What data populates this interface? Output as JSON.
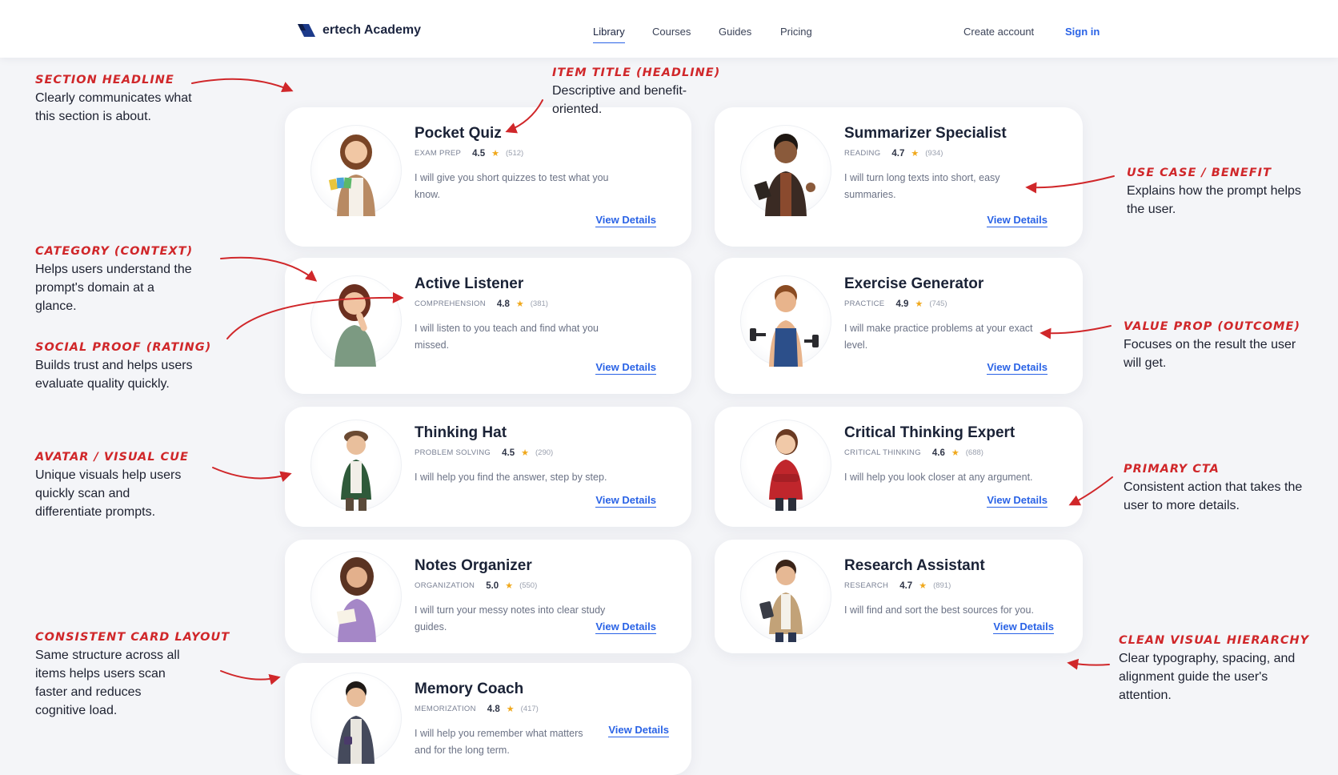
{
  "nav": {
    "brand": "ertech Academy",
    "links": [
      "Library",
      "Courses",
      "Guides",
      "Pricing"
    ],
    "create_account": "Create account",
    "sign_in": "Sign in"
  },
  "colors": {
    "accent": "#2a63e6",
    "annotation": "#d0272a",
    "star": "#f0a81b"
  },
  "cards": [
    {
      "title": "Pocket Quiz",
      "category": "EXAM PREP",
      "rating": "4.5",
      "count": "(512)",
      "description": "I will give you short quizzes to test what you know.",
      "cta": "View Details",
      "avatar": "woman-with-cards-avatar"
    },
    {
      "title": "Summarizer Specialist",
      "category": "READING",
      "rating": "4.7",
      "count": "(934)",
      "description": "I will turn long texts into short, easy summaries.",
      "cta": "View Details",
      "avatar": "man-with-book-avatar"
    },
    {
      "title": "Active Listener",
      "category": "COMPREHENSION",
      "rating": "4.8",
      "count": "(381)",
      "description": "I will listen to you teach and find what you missed.",
      "cta": "View Details",
      "avatar": "woman-thinking-avatar"
    },
    {
      "title": "Exercise Generator",
      "category": "PRACTICE",
      "rating": "4.9",
      "count": "(745)",
      "description": "I will make practice problems at your exact level.",
      "cta": "View Details",
      "avatar": "man-with-dumbbells-avatar"
    },
    {
      "title": "Thinking Hat",
      "category": "PROBLEM SOLVING",
      "rating": "4.5",
      "count": "(290)",
      "description": "I will help you find the answer, step by step.",
      "cta": "View Details",
      "avatar": "man-with-hat-avatar"
    },
    {
      "title": "Critical Thinking Expert",
      "category": "CRITICAL THINKING",
      "rating": "4.6",
      "count": "(688)",
      "description": "I will help you look closer at any argument.",
      "cta": "View Details",
      "avatar": "woman-arms-crossed-avatar"
    },
    {
      "title": "Notes Organizer",
      "category": "ORGANIZATION",
      "rating": "5.0",
      "count": "(550)",
      "description": "I will turn your messy notes into clear study guides.",
      "cta": "View Details",
      "avatar": "woman-with-notebook-avatar"
    },
    {
      "title": "Research Assistant",
      "category": "RESEARCH",
      "rating": "4.7",
      "count": "(891)",
      "description": "I will find and sort the best sources for you.",
      "cta": "View Details",
      "avatar": "man-with-tablet-avatar"
    },
    {
      "title": "Memory Coach",
      "category": "MEMORIZATION",
      "rating": "4.8",
      "count": "(417)",
      "description": "I will help you remember what matters and for the long term.",
      "cta": "View Details",
      "avatar": "man-in-hoodie-avatar"
    }
  ],
  "annotations": [
    {
      "heading": "SECTION HEADLINE",
      "body": "Clearly communicates what this section is about."
    },
    {
      "heading": "ITEM TITLE (HEADLINE)",
      "body": "Descriptive and benefit-oriented."
    },
    {
      "heading": "CATEGORY (CONTEXT)",
      "body": "Helps users understand the prompt's domain at a glance."
    },
    {
      "heading": "SOCIAL PROOF (RATING)",
      "body": "Builds trust and helps users evaluate quality quickly."
    },
    {
      "heading": "AVATAR / VISUAL CUE",
      "body": "Unique visuals help users quickly scan and differentiate prompts."
    },
    {
      "heading": "CONSISTENT CARD LAYOUT",
      "body": "Same structure across all items helps users scan faster and reduces cognitive load."
    },
    {
      "heading": "USE CASE / BENEFIT",
      "body": "Explains how the prompt helps the user."
    },
    {
      "heading": "VALUE PROP (OUTCOME)",
      "body": "Focuses on the result the user will get."
    },
    {
      "heading": "PRIMARY CTA",
      "body": "Consistent action that takes the user to more details."
    },
    {
      "heading": "CLEAN VISUAL HIERARCHY",
      "body": "Clear typography, spacing, and alignment guide the user's attention."
    }
  ]
}
